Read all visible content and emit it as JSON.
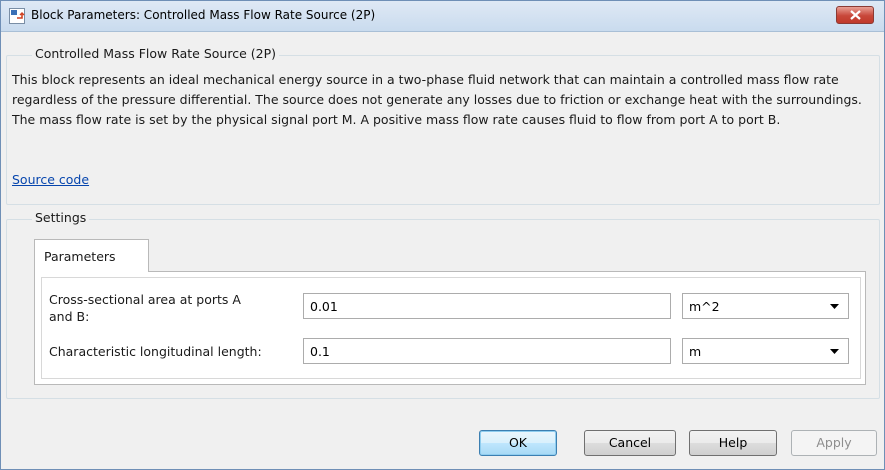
{
  "window": {
    "title": "Block Parameters: Controlled Mass Flow Rate Source (2P)"
  },
  "block": {
    "name": "Controlled Mass Flow Rate Source (2P)",
    "description": "This block represents an ideal mechanical energy source in a two-phase fluid network that can maintain a controlled mass flow rate regardless of the pressure differential. The source does not generate any losses due to friction or exchange heat with the surroundings. The mass flow rate is set by the physical signal port M. A positive mass flow rate causes fluid to flow from port A to port B.",
    "source_link": "Source code"
  },
  "settings": {
    "title": "Settings",
    "tabs": [
      {
        "label": "Parameters",
        "active": true
      }
    ],
    "params": [
      {
        "label_line1": "Cross-sectional area at ports A",
        "label_line2": "and B:",
        "value": "0.01",
        "unit": "m^2"
      },
      {
        "label": "Characteristic longitudinal length:",
        "value": "0.1",
        "unit": "m"
      }
    ]
  },
  "buttons": {
    "ok": "OK",
    "cancel": "Cancel",
    "help": "Help",
    "apply": "Apply"
  },
  "colors": {
    "link": "#0645ad",
    "close_button": "#c0392b",
    "titlebar": "#c9dbee"
  }
}
